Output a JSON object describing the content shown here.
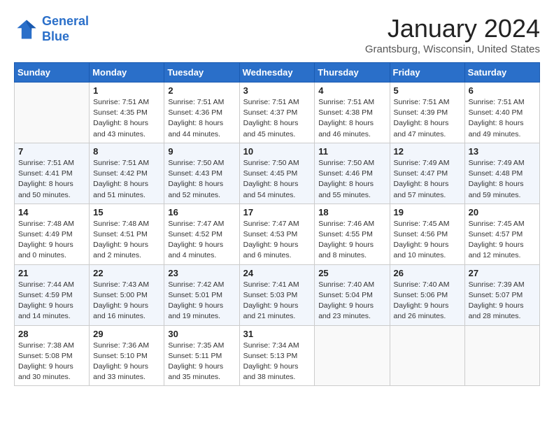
{
  "header": {
    "logo_line1": "General",
    "logo_line2": "Blue",
    "month_year": "January 2024",
    "location": "Grantsburg, Wisconsin, United States"
  },
  "days_of_week": [
    "Sunday",
    "Monday",
    "Tuesday",
    "Wednesday",
    "Thursday",
    "Friday",
    "Saturday"
  ],
  "weeks": [
    [
      {
        "day": "",
        "info": ""
      },
      {
        "day": "1",
        "info": "Sunrise: 7:51 AM\nSunset: 4:35 PM\nDaylight: 8 hours\nand 43 minutes."
      },
      {
        "day": "2",
        "info": "Sunrise: 7:51 AM\nSunset: 4:36 PM\nDaylight: 8 hours\nand 44 minutes."
      },
      {
        "day": "3",
        "info": "Sunrise: 7:51 AM\nSunset: 4:37 PM\nDaylight: 8 hours\nand 45 minutes."
      },
      {
        "day": "4",
        "info": "Sunrise: 7:51 AM\nSunset: 4:38 PM\nDaylight: 8 hours\nand 46 minutes."
      },
      {
        "day": "5",
        "info": "Sunrise: 7:51 AM\nSunset: 4:39 PM\nDaylight: 8 hours\nand 47 minutes."
      },
      {
        "day": "6",
        "info": "Sunrise: 7:51 AM\nSunset: 4:40 PM\nDaylight: 8 hours\nand 49 minutes."
      }
    ],
    [
      {
        "day": "7",
        "info": "Sunrise: 7:51 AM\nSunset: 4:41 PM\nDaylight: 8 hours\nand 50 minutes."
      },
      {
        "day": "8",
        "info": "Sunrise: 7:51 AM\nSunset: 4:42 PM\nDaylight: 8 hours\nand 51 minutes."
      },
      {
        "day": "9",
        "info": "Sunrise: 7:50 AM\nSunset: 4:43 PM\nDaylight: 8 hours\nand 52 minutes."
      },
      {
        "day": "10",
        "info": "Sunrise: 7:50 AM\nSunset: 4:45 PM\nDaylight: 8 hours\nand 54 minutes."
      },
      {
        "day": "11",
        "info": "Sunrise: 7:50 AM\nSunset: 4:46 PM\nDaylight: 8 hours\nand 55 minutes."
      },
      {
        "day": "12",
        "info": "Sunrise: 7:49 AM\nSunset: 4:47 PM\nDaylight: 8 hours\nand 57 minutes."
      },
      {
        "day": "13",
        "info": "Sunrise: 7:49 AM\nSunset: 4:48 PM\nDaylight: 8 hours\nand 59 minutes."
      }
    ],
    [
      {
        "day": "14",
        "info": "Sunrise: 7:48 AM\nSunset: 4:49 PM\nDaylight: 9 hours\nand 0 minutes."
      },
      {
        "day": "15",
        "info": "Sunrise: 7:48 AM\nSunset: 4:51 PM\nDaylight: 9 hours\nand 2 minutes."
      },
      {
        "day": "16",
        "info": "Sunrise: 7:47 AM\nSunset: 4:52 PM\nDaylight: 9 hours\nand 4 minutes."
      },
      {
        "day": "17",
        "info": "Sunrise: 7:47 AM\nSunset: 4:53 PM\nDaylight: 9 hours\nand 6 minutes."
      },
      {
        "day": "18",
        "info": "Sunrise: 7:46 AM\nSunset: 4:55 PM\nDaylight: 9 hours\nand 8 minutes."
      },
      {
        "day": "19",
        "info": "Sunrise: 7:45 AM\nSunset: 4:56 PM\nDaylight: 9 hours\nand 10 minutes."
      },
      {
        "day": "20",
        "info": "Sunrise: 7:45 AM\nSunset: 4:57 PM\nDaylight: 9 hours\nand 12 minutes."
      }
    ],
    [
      {
        "day": "21",
        "info": "Sunrise: 7:44 AM\nSunset: 4:59 PM\nDaylight: 9 hours\nand 14 minutes."
      },
      {
        "day": "22",
        "info": "Sunrise: 7:43 AM\nSunset: 5:00 PM\nDaylight: 9 hours\nand 16 minutes."
      },
      {
        "day": "23",
        "info": "Sunrise: 7:42 AM\nSunset: 5:01 PM\nDaylight: 9 hours\nand 19 minutes."
      },
      {
        "day": "24",
        "info": "Sunrise: 7:41 AM\nSunset: 5:03 PM\nDaylight: 9 hours\nand 21 minutes."
      },
      {
        "day": "25",
        "info": "Sunrise: 7:40 AM\nSunset: 5:04 PM\nDaylight: 9 hours\nand 23 minutes."
      },
      {
        "day": "26",
        "info": "Sunrise: 7:40 AM\nSunset: 5:06 PM\nDaylight: 9 hours\nand 26 minutes."
      },
      {
        "day": "27",
        "info": "Sunrise: 7:39 AM\nSunset: 5:07 PM\nDaylight: 9 hours\nand 28 minutes."
      }
    ],
    [
      {
        "day": "28",
        "info": "Sunrise: 7:38 AM\nSunset: 5:08 PM\nDaylight: 9 hours\nand 30 minutes."
      },
      {
        "day": "29",
        "info": "Sunrise: 7:36 AM\nSunset: 5:10 PM\nDaylight: 9 hours\nand 33 minutes."
      },
      {
        "day": "30",
        "info": "Sunrise: 7:35 AM\nSunset: 5:11 PM\nDaylight: 9 hours\nand 35 minutes."
      },
      {
        "day": "31",
        "info": "Sunrise: 7:34 AM\nSunset: 5:13 PM\nDaylight: 9 hours\nand 38 minutes."
      },
      {
        "day": "",
        "info": ""
      },
      {
        "day": "",
        "info": ""
      },
      {
        "day": "",
        "info": ""
      }
    ]
  ]
}
